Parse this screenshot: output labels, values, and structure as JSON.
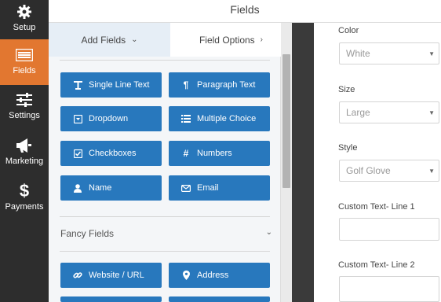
{
  "header": {
    "title": "Fields"
  },
  "sidebar": {
    "items": [
      {
        "label": "Setup",
        "icon": "gear-icon"
      },
      {
        "label": "Fields",
        "icon": "fields-list-icon",
        "active": true
      },
      {
        "label": "Settings",
        "icon": "sliders-icon"
      },
      {
        "label": "Marketing",
        "icon": "megaphone-icon"
      },
      {
        "label": "Payments",
        "icon": "dollar-icon"
      }
    ]
  },
  "tabs": {
    "add_fields": "Add Fields",
    "field_options": "Field Options"
  },
  "standard_fields": [
    {
      "label": "Single Line Text",
      "icon": "text-cursor-icon"
    },
    {
      "label": "Paragraph Text",
      "icon": "paragraph-icon"
    },
    {
      "label": "Dropdown",
      "icon": "dropdown-icon"
    },
    {
      "label": "Multiple Choice",
      "icon": "list-icon"
    },
    {
      "label": "Checkboxes",
      "icon": "checkbox-icon"
    },
    {
      "label": "Numbers",
      "icon": "hash-icon"
    },
    {
      "label": "Name",
      "icon": "user-icon"
    },
    {
      "label": "Email",
      "icon": "envelope-icon"
    }
  ],
  "fancy_fields": {
    "header": "Fancy Fields",
    "items": [
      {
        "label": "Website / URL",
        "icon": "link-icon"
      },
      {
        "label": "Address",
        "icon": "map-marker-icon"
      }
    ]
  },
  "options": {
    "color": {
      "label": "Color",
      "value": "White"
    },
    "size": {
      "label": "Size",
      "value": "Large"
    },
    "style": {
      "label": "Style",
      "value": "Golf Glove"
    },
    "custom_line_1": {
      "label": "Custom Text- Line 1",
      "value": ""
    },
    "custom_line_2": {
      "label": "Custom Text- Line 2",
      "value": ""
    }
  },
  "colors": {
    "sidebar_bg": "#2d2d2d",
    "active_orange": "#e27730",
    "button_blue": "#2878bd",
    "panel_bg": "#f4f6f8"
  }
}
